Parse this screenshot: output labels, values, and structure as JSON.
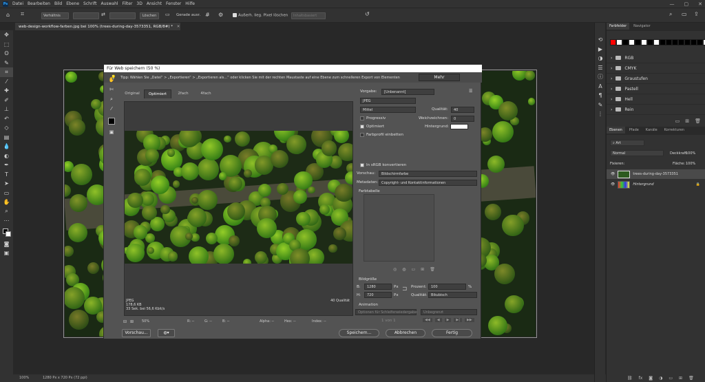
{
  "app": {
    "logo": "Ps"
  },
  "menu": [
    "Datei",
    "Bearbeiten",
    "Bild",
    "Ebene",
    "Schrift",
    "Auswahl",
    "Filter",
    "3D",
    "Ansicht",
    "Fenster",
    "Hilfe"
  ],
  "options": {
    "ratio": "Verhältnis",
    "clear": "Löschen",
    "straighten": "Gerade ausr.",
    "delete_pixels": "Außerh. lieg. Pixel löschen",
    "content_aware": "Inhaltsbasiert"
  },
  "document": {
    "tab_title": "web-design-workflow-farben.jpg bei 100% (trees-during-day-3573351, RGB/8#) *"
  },
  "status": {
    "zoom": "100%",
    "size": "1280 Px x 720 Px (72 ppi)"
  },
  "panels": {
    "swatch_tabs": [
      "Farbfelder",
      "Navigator"
    ],
    "swatch_colors": [
      "#ff0000",
      "#ffffff",
      "#000000",
      "#ffffff",
      "#000000",
      "#ffffff",
      "#000000",
      "#ffffff",
      "#000000",
      "#000000",
      "#000000",
      "#000000",
      "#000000",
      "#000000",
      "#000000",
      "#ffffff"
    ],
    "folders": [
      "RGB",
      "CMYK",
      "Graustufen",
      "Pastell",
      "Hell",
      "Rein"
    ],
    "layer_tabs": [
      "Ebenen",
      "Pfade",
      "Kanäle",
      "Korrekturen"
    ],
    "filter": "Art",
    "blend_mode": "Normal",
    "opacity_label": "Deckkraft:",
    "opacity_value": "100%",
    "lock_label": "Fixieren:",
    "fill_label": "Fläche:",
    "fill_value": "100%",
    "layers": [
      {
        "name": "trees-during-day-3573351"
      },
      {
        "name": "Hintergrund"
      }
    ]
  },
  "dialog": {
    "title": "Für Web speichern (50 %)",
    "tip": "Tipp: Wählen Sie „Datei“ > „Exportieren“ > „Exportieren als...“ oder klicken Sie mit der rechten Maustaste auf eine Ebene zum schnelleren Export von Elementen",
    "more_button": "Mehr",
    "view_tabs": [
      "Original",
      "Optimiert",
      "2fach",
      "4fach"
    ],
    "preview_info": {
      "format": "JPEG",
      "filesize": "178,6 KB",
      "timing": "33 Sek. bei 56,6 Kbit/s",
      "quality": "40 Qualität"
    },
    "bottom": {
      "zoom": "50%",
      "r": "R: --",
      "g": "G: --",
      "b": "B: --",
      "alpha": "Alpha: --",
      "hex": "Hex: --",
      "index": "Index: --"
    },
    "settings": {
      "preset_label": "Vorgabe:",
      "preset_value": "[Unbenannt]",
      "format": "JPEG",
      "quality_level": "Mittel",
      "quality_label": "Qualität:",
      "quality_value": "40",
      "progressive": "Progressiv",
      "blur_label": "Weichzeichnen:",
      "blur_value": "0",
      "optimized": "Optimiert",
      "matte_label": "Hintergrund:",
      "embed_profile": "Farbprofil einbetten",
      "convert_srgb": "In sRGB konvertieren",
      "preview_label": "Vorschau:",
      "preview_value": "Bildschirmfarbe",
      "metadata_label": "Metadaten:",
      "metadata_value": "Copyright- und Kontaktinformationen",
      "color_table": "Farbtabelle",
      "image_size": "Bildgröße",
      "w_label": "B:",
      "w_value": "1280",
      "h_label": "H:",
      "h_value": "720",
      "unit": "Px",
      "percent_label": "Prozent:",
      "percent_value": "100",
      "percent_unit": "%",
      "resample_label": "Qualität:",
      "resample_value": "Bikubisch",
      "animation": "Animation",
      "loop_label": "Optionen für Schleifenwiedergabe:",
      "loop_value": "Unbegrenzt",
      "frame": "1 von 1"
    },
    "buttons": {
      "preview": "Vorschau...",
      "save": "Speichern...",
      "cancel": "Abbrechen",
      "done": "Fertig"
    }
  }
}
